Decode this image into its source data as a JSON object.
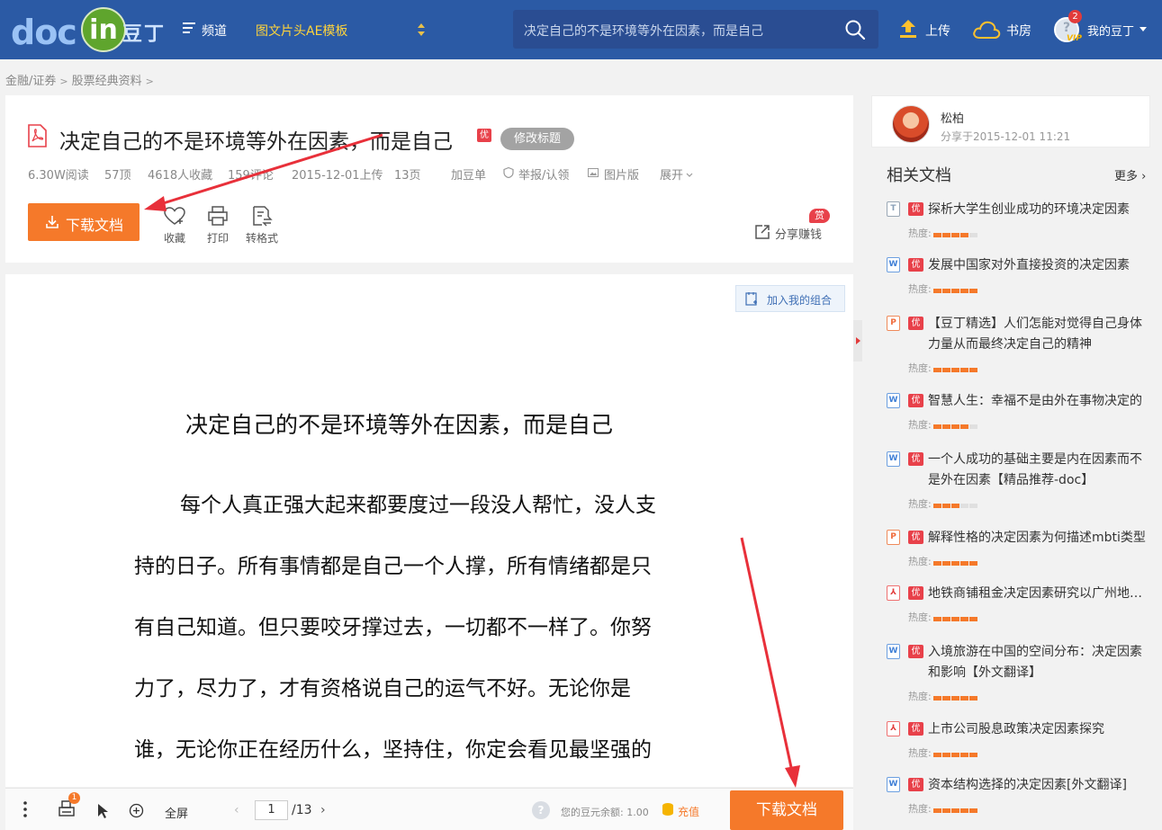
{
  "header": {
    "logo_doc": "doc",
    "logo_in": "in",
    "logo_cn": "豆丁",
    "channel_label": "频道",
    "template_link": "图文片头AE模板",
    "search_value": "决定自己的不是环境等外在因素，而是自己",
    "upload_label": "上传",
    "bookroom_label": "书房",
    "notification_count": "2",
    "vip_label": "VIP",
    "my_label": "我的豆丁",
    "accent": "#2b5aa5"
  },
  "breadcrumb": {
    "items": [
      "金融/证券",
      "股票经典资料"
    ],
    "separator": ">"
  },
  "document": {
    "title": "决定自己的不是环境等外在因素，而是自己",
    "quality_badge": "优",
    "modify_title_label": "修改标题",
    "reads": "6.30W阅读",
    "likes": "57顶",
    "favorites_count": "4618人收藏",
    "comments": "159评论",
    "upload_date": "2015-12-01上传",
    "pages": "13页",
    "add_doudan": "加豆单",
    "report": "举报/认领",
    "image_version": "图片版",
    "expand": "展开",
    "download_label": "下载文档",
    "collect_label": "收藏",
    "print_label": "打印",
    "convert_label": "转格式",
    "share_label": "分享赚钱",
    "reward_badge": "赏"
  },
  "viewer": {
    "add_combo_label": "加入我的组合",
    "heading": "决定自己的不是环境等外在因素，而是自己",
    "lines": [
      "每个人真正强大起来都要度过一段没人帮忙，没人支",
      "持的日子。所有事情都是自己一个人撑，所有情绪都是只",
      "有自己知道。但只要咬牙撑过去，一切都不一样了。你努",
      "力了，尽力了，才有资格说自己的运气不好。无论你是",
      "谁，无论你正在经历什么，坚持住，你定会看见最坚强的"
    ]
  },
  "bottom_bar": {
    "print_count": "1",
    "fullscreen_label": "全屏",
    "current_page": "1",
    "total_pages": "/13",
    "balance_label": "您的豆元余额: 1.00",
    "recharge_label": "充值",
    "download_label": "下载文档"
  },
  "sidebar": {
    "author_name": "松柏",
    "author_date": "分享于2015-12-01 11:21",
    "related_title": "相关文档",
    "more_label": "更多",
    "heat_label": "热度:",
    "items": [
      {
        "icon": "txt",
        "title": "探析大学生创业成功的环境决定因素",
        "heat": 4
      },
      {
        "icon": "word",
        "title": "发展中国家对外直接投资的决定因素",
        "heat": 5
      },
      {
        "icon": "ppt",
        "title": "【豆丁精选】人们怎能对觉得自己身体力量从而最终决定自己的精神",
        "heat": 5
      },
      {
        "icon": "word",
        "title": "智慧人生：幸福不是由外在事物决定的",
        "heat": 4
      },
      {
        "icon": "word",
        "title": "一个人成功的基础主要是内在因素而不是外在因素【精品推荐-doc】",
        "heat": 3
      },
      {
        "icon": "ppt",
        "title": "解释性格的决定因素为何描述mbti类型",
        "heat": 5
      },
      {
        "icon": "pdf",
        "title": "地铁商铺租金决定因素研究以广州地铁为例",
        "heat": 5
      },
      {
        "icon": "word",
        "title": "入境旅游在中国的空间分布：决定因素和影响【外文翻译】",
        "heat": 5
      },
      {
        "icon": "pdf",
        "title": "上市公司股息政策决定因素探究",
        "heat": 5
      },
      {
        "icon": "word",
        "title": "资本结构选择的决定因素[外文翻译]",
        "heat": 5
      }
    ]
  },
  "colors": {
    "download_orange": "#f5792a",
    "badge_red": "#e8414a",
    "arrow_red": "#e8303a"
  }
}
